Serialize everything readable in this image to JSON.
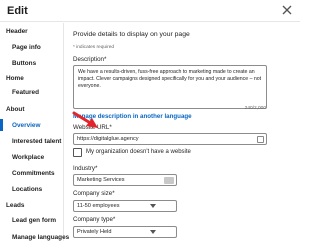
{
  "header": {
    "title": "Edit"
  },
  "sidebar": {
    "sections": [
      {
        "label": "Header",
        "items": [
          {
            "label": "Page info"
          },
          {
            "label": "Buttons"
          }
        ]
      },
      {
        "label": "Home",
        "items": [
          {
            "label": "Featured"
          }
        ]
      },
      {
        "label": "About",
        "items": [
          {
            "label": "Overview",
            "active": true
          },
          {
            "label": "Interested talent"
          },
          {
            "label": "Workplace"
          },
          {
            "label": "Commitments"
          },
          {
            "label": "Locations"
          }
        ]
      },
      {
        "label": "Leads",
        "items": [
          {
            "label": "Lead gen form"
          }
        ]
      }
    ],
    "bottom_item": "Manage languages"
  },
  "main": {
    "heading": "Provide details to display on your page",
    "required_note": "* indicates required",
    "description": {
      "label": "Description*",
      "value": "We have a results-driven, fuss-free approach to marketing made to create an impact. Clever campaigns designed specifically for you and your audience – not everyone.",
      "counter": "240/2,000"
    },
    "manage_link": "Manage description in another language",
    "website": {
      "label": "Website URL*",
      "value": "https://digitalglue.agency"
    },
    "no_website": {
      "label": "My organization doesn't have a website"
    },
    "industry": {
      "label": "Industry*",
      "value": "Marketing Services"
    },
    "company_size": {
      "label": "Company size*",
      "value": "11-50 employees"
    },
    "company_type": {
      "label": "Company type*",
      "value": "Privately Held"
    }
  },
  "annotation": {
    "color": "#e3242b"
  }
}
